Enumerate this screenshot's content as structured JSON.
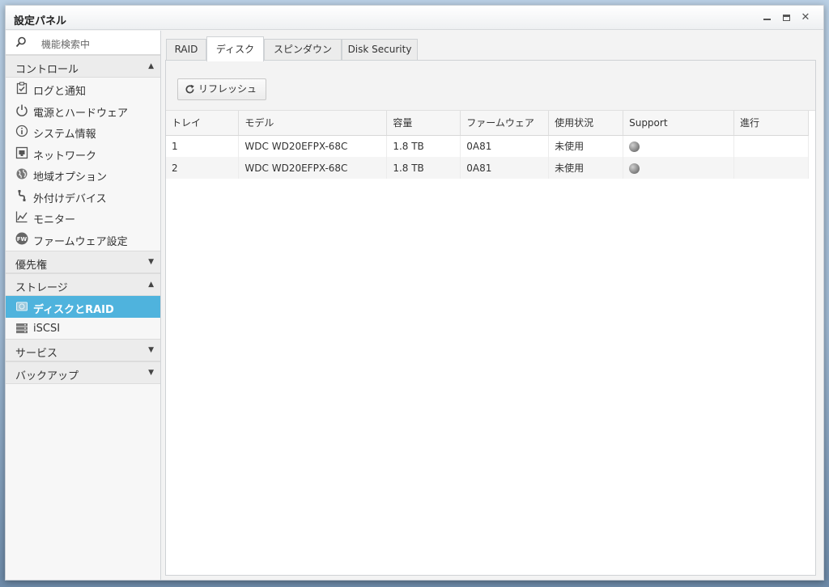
{
  "window": {
    "title": "設定パネル"
  },
  "sidebar": {
    "search_placeholder": "機能検索中",
    "sections": {
      "control": {
        "label": "コントロール"
      },
      "priority": {
        "label": "優先権"
      },
      "storage": {
        "label": "ストレージ"
      },
      "services": {
        "label": "サービス"
      },
      "backup": {
        "label": "バックアップ"
      }
    },
    "control_items": [
      {
        "label": "ログと通知",
        "icon": "clipboard-check-icon"
      },
      {
        "label": "電源とハードウェア",
        "icon": "power-icon"
      },
      {
        "label": "システム情報",
        "icon": "info-icon"
      },
      {
        "label": "ネットワーク",
        "icon": "network-icon"
      },
      {
        "label": "地域オプション",
        "icon": "globe-icon"
      },
      {
        "label": "外付けデバイス",
        "icon": "usb-icon"
      },
      {
        "label": "モニター",
        "icon": "chart-icon"
      },
      {
        "label": "ファームウェア設定",
        "icon": "fw-icon",
        "badge": "FW"
      }
    ],
    "storage_items": [
      {
        "label": "ディスクとRAID",
        "icon": "disk-icon"
      },
      {
        "label": "iSCSI",
        "icon": "server-icon"
      }
    ]
  },
  "tabs": [
    {
      "label": "RAID"
    },
    {
      "label": "ディスク"
    },
    {
      "label": "スピンダウン"
    },
    {
      "label": "Disk Security"
    }
  ],
  "toolbar": {
    "refresh_label": "リフレッシュ"
  },
  "table": {
    "columns": [
      "トレイ",
      "モデル",
      "容量",
      "ファームウェア",
      "使用状況",
      "Support",
      "進行"
    ],
    "rows": [
      {
        "tray": "1",
        "model": "WDC WD20EFPX-68C",
        "capacity": "1.8 TB",
        "firmware": "0A81",
        "status": "未使用",
        "support": "gray-dot",
        "progress": ""
      },
      {
        "tray": "2",
        "model": "WDC WD20EFPX-68C",
        "capacity": "1.8 TB",
        "firmware": "0A81",
        "status": "未使用",
        "support": "gray-dot",
        "progress": ""
      }
    ]
  },
  "colors": {
    "accent": "#4fb3dd",
    "border": "#cfd2d5"
  }
}
